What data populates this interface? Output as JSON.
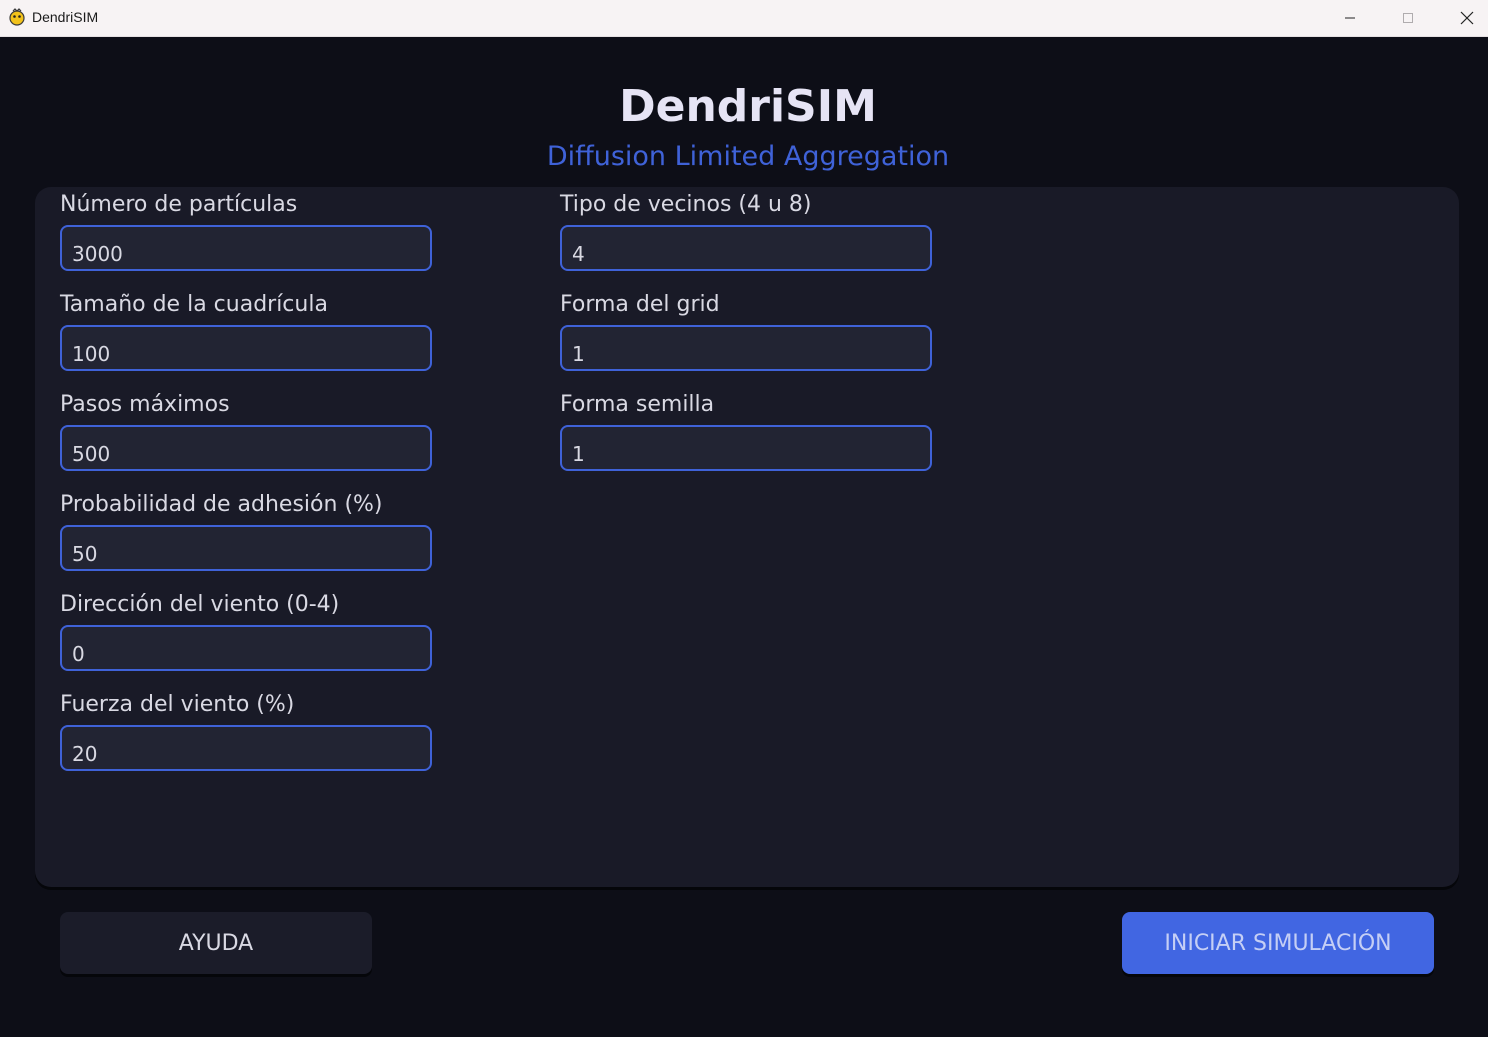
{
  "window": {
    "title": "DendriSIM"
  },
  "header": {
    "title": "DendriSIM",
    "subtitle": "Diffusion Limited Aggregation"
  },
  "form": {
    "left": [
      {
        "label": "Número de partículas",
        "value": "3000"
      },
      {
        "label": "Tamaño de la cuadrícula",
        "value": "100"
      },
      {
        "label": "Pasos máximos",
        "value": "500"
      },
      {
        "label": "Probabilidad de adhesión (%)",
        "value": "50"
      },
      {
        "label": "Dirección del viento (0-4)",
        "value": "0"
      },
      {
        "label": "Fuerza del viento (%)",
        "value": "20"
      }
    ],
    "right": [
      {
        "label": "Tipo de vecinos (4 u 8)",
        "value": "4"
      },
      {
        "label": "Forma del grid",
        "value": "1"
      },
      {
        "label": "Forma semilla",
        "value": "1"
      }
    ]
  },
  "buttons": {
    "help": "AYUDA",
    "start": "INICIAR SIMULACIÓN"
  },
  "colors": {
    "accent": "#4166e2",
    "background": "#0d0e17",
    "panel": "#191a27",
    "input_bg": "#222433",
    "text": "#d9d9e3"
  },
  "icons": {
    "app": "pygame-snake-icon",
    "minimize": "minimize-icon",
    "maximize": "maximize-icon",
    "close": "close-icon"
  }
}
